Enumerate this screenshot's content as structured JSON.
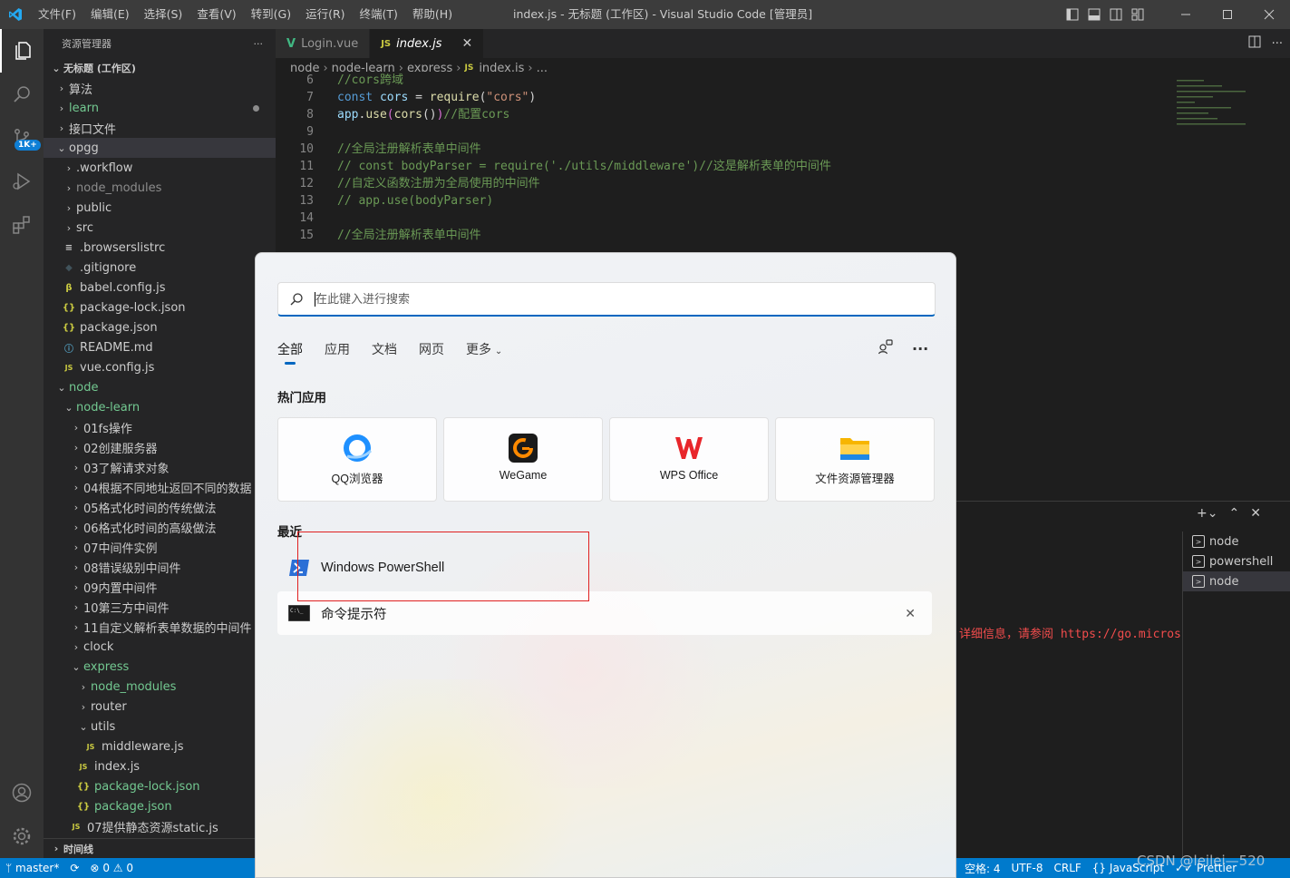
{
  "titlebar": {
    "menu": [
      "文件(F)",
      "编辑(E)",
      "选择(S)",
      "查看(V)",
      "转到(G)",
      "运行(R)",
      "终端(T)",
      "帮助(H)"
    ],
    "window_title": "index.js - 无标题 (工作区) - Visual Studio Code [管理员]"
  },
  "activitybar": {
    "source_control_badge": "1K+"
  },
  "sidebar": {
    "header": "资源管理器",
    "more": "···",
    "workspace": "无标题 (工作区)",
    "tree": [
      {
        "label": "算法",
        "depth": 1,
        "type": "folder",
        "open": false
      },
      {
        "label": "learn",
        "depth": 1,
        "type": "folder",
        "open": false,
        "color": "green",
        "dot": true
      },
      {
        "label": "接口文件",
        "depth": 1,
        "type": "folder",
        "open": false
      },
      {
        "label": "opgg",
        "depth": 1,
        "type": "folder",
        "open": true,
        "selected": true
      },
      {
        "label": ".workflow",
        "depth": 2,
        "type": "folder",
        "open": false
      },
      {
        "label": "node_modules",
        "depth": 2,
        "type": "folder",
        "open": false,
        "color": "dim"
      },
      {
        "label": "public",
        "depth": 2,
        "type": "folder",
        "open": false
      },
      {
        "label": "src",
        "depth": 2,
        "type": "folder",
        "open": false
      },
      {
        "label": ".browserslistrc",
        "depth": 2,
        "type": "file",
        "icon": "≡"
      },
      {
        "label": ".gitignore",
        "depth": 2,
        "type": "file",
        "icon": "◆"
      },
      {
        "label": "babel.config.js",
        "depth": 2,
        "type": "file",
        "icon": "β"
      },
      {
        "label": "package-lock.json",
        "depth": 2,
        "type": "file",
        "icon": "{}"
      },
      {
        "label": "package.json",
        "depth": 2,
        "type": "file",
        "icon": "{}"
      },
      {
        "label": "README.md",
        "depth": 2,
        "type": "file",
        "icon": "ⓘ"
      },
      {
        "label": "vue.config.js",
        "depth": 2,
        "type": "file",
        "icon": "JS"
      },
      {
        "label": "node",
        "depth": 1,
        "type": "folder",
        "open": true,
        "color": "green"
      },
      {
        "label": "node-learn",
        "depth": 2,
        "type": "folder",
        "open": true,
        "color": "green"
      },
      {
        "label": "01fs操作",
        "depth": 3,
        "type": "folder",
        "open": false
      },
      {
        "label": "02创建服务器",
        "depth": 3,
        "type": "folder",
        "open": false
      },
      {
        "label": "03了解请求对象",
        "depth": 3,
        "type": "folder",
        "open": false
      },
      {
        "label": "04根据不同地址返回不同的数据",
        "depth": 3,
        "type": "folder",
        "open": false
      },
      {
        "label": "05格式化时间的传统做法",
        "depth": 3,
        "type": "folder",
        "open": false
      },
      {
        "label": "06格式化时间的高级做法",
        "depth": 3,
        "type": "folder",
        "open": false
      },
      {
        "label": "07中间件实例",
        "depth": 3,
        "type": "folder",
        "open": false
      },
      {
        "label": "08错误级别中间件",
        "depth": 3,
        "type": "folder",
        "open": false
      },
      {
        "label": "09内置中间件",
        "depth": 3,
        "type": "folder",
        "open": false
      },
      {
        "label": "10第三方中间件",
        "depth": 3,
        "type": "folder",
        "open": false
      },
      {
        "label": "11自定义解析表单数据的中间件",
        "depth": 3,
        "type": "folder",
        "open": false
      },
      {
        "label": "clock",
        "depth": 3,
        "type": "folder",
        "open": false
      },
      {
        "label": "express",
        "depth": 3,
        "type": "folder",
        "open": true,
        "color": "green"
      },
      {
        "label": "node_modules",
        "depth": 4,
        "type": "folder",
        "open": false,
        "color": "green"
      },
      {
        "label": "router",
        "depth": 4,
        "type": "folder",
        "open": false
      },
      {
        "label": "utils",
        "depth": 4,
        "type": "folder",
        "open": true
      },
      {
        "label": "middleware.js",
        "depth": 5,
        "type": "file",
        "icon": "JS"
      },
      {
        "label": "index.js",
        "depth": 4,
        "type": "file",
        "icon": "JS"
      },
      {
        "label": "package-lock.json",
        "depth": 4,
        "type": "file",
        "icon": "{}",
        "color": "green"
      },
      {
        "label": "package.json",
        "depth": 4,
        "type": "file",
        "icon": "{}",
        "color": "green"
      },
      {
        "label": "07提供静态资源static.js",
        "depth": 3,
        "type": "file",
        "icon": "JS"
      }
    ],
    "footer": "时间线"
  },
  "tabs": [
    {
      "label": "Login.vue",
      "icon": "V",
      "active": false
    },
    {
      "label": "index.js",
      "icon": "JS",
      "active": true,
      "close": "✕"
    }
  ],
  "breadcrumb": [
    "node",
    "node-learn",
    "express",
    "index.js",
    "..."
  ],
  "code": [
    {
      "n": "6",
      "tokens": [
        [
          "cm",
          "//cors跨域"
        ]
      ]
    },
    {
      "n": "7",
      "tokens": [
        [
          "kw",
          "const "
        ],
        [
          "vr",
          "cors"
        ],
        [
          "pl",
          " = "
        ],
        [
          "fn",
          "require"
        ],
        [
          "pl",
          "("
        ],
        [
          "st",
          "\"cors\""
        ],
        [
          "pl",
          ")"
        ]
      ]
    },
    {
      "n": "8",
      "tokens": [
        [
          "vr",
          "app"
        ],
        [
          "pl",
          "."
        ],
        [
          "fn",
          "use"
        ],
        [
          "pn",
          "("
        ],
        [
          "fn",
          "cors"
        ],
        [
          "pl",
          "()"
        ],
        [
          "pn",
          ")"
        ],
        [
          "cm",
          "//配置cors"
        ]
      ]
    },
    {
      "n": "9",
      "tokens": []
    },
    {
      "n": "10",
      "tokens": [
        [
          "cm",
          "//全局注册解析表单中间件"
        ]
      ]
    },
    {
      "n": "11",
      "tokens": [
        [
          "cm",
          "// const bodyParser = require('./utils/middleware')//这是解析表单的中间件"
        ]
      ]
    },
    {
      "n": "12",
      "tokens": [
        [
          "cm",
          "//自定义函数注册为全局使用的中间件"
        ]
      ]
    },
    {
      "n": "13",
      "tokens": [
        [
          "cm",
          "// app.use(bodyParser)"
        ]
      ]
    },
    {
      "n": "14",
      "tokens": []
    },
    {
      "n": "15",
      "tokens": [
        [
          "cm",
          "//全局注册解析表单中间件"
        ]
      ]
    }
  ],
  "panel": {
    "terminals": [
      {
        "label": "node",
        "selected": false
      },
      {
        "label": "powershell",
        "selected": false
      },
      {
        "label": "node",
        "selected": true
      }
    ],
    "terminal_text": "详细信息，请参阅 https://go.micros"
  },
  "statusbar": {
    "branch": "master*",
    "errors": "0",
    "warnings": "0",
    "spaces": "空格: 4",
    "encoding": "UTF-8",
    "eol": "CRLF",
    "language": "JavaScript",
    "prettier": "Prettier"
  },
  "watermark": "CSDN @leilei—520",
  "search_flyout": {
    "placeholder": "在此键入进行搜索",
    "filters": [
      "全部",
      "应用",
      "文档",
      "网页",
      "更多"
    ],
    "hot_apps_title": "热门应用",
    "hot_apps": [
      {
        "label": "QQ浏览器",
        "icon": "qq-browser"
      },
      {
        "label": "WeGame",
        "icon": "wegame"
      },
      {
        "label": "WPS Office",
        "icon": "wps"
      },
      {
        "label": "文件资源管理器",
        "icon": "file-explorer"
      }
    ],
    "recent_title": "最近",
    "recent": [
      {
        "label": "Windows PowerShell",
        "icon": "powershell"
      },
      {
        "label": "命令提示符",
        "icon": "cmd"
      }
    ],
    "accent": "#0067c0",
    "annotation_color": "#e02020"
  }
}
